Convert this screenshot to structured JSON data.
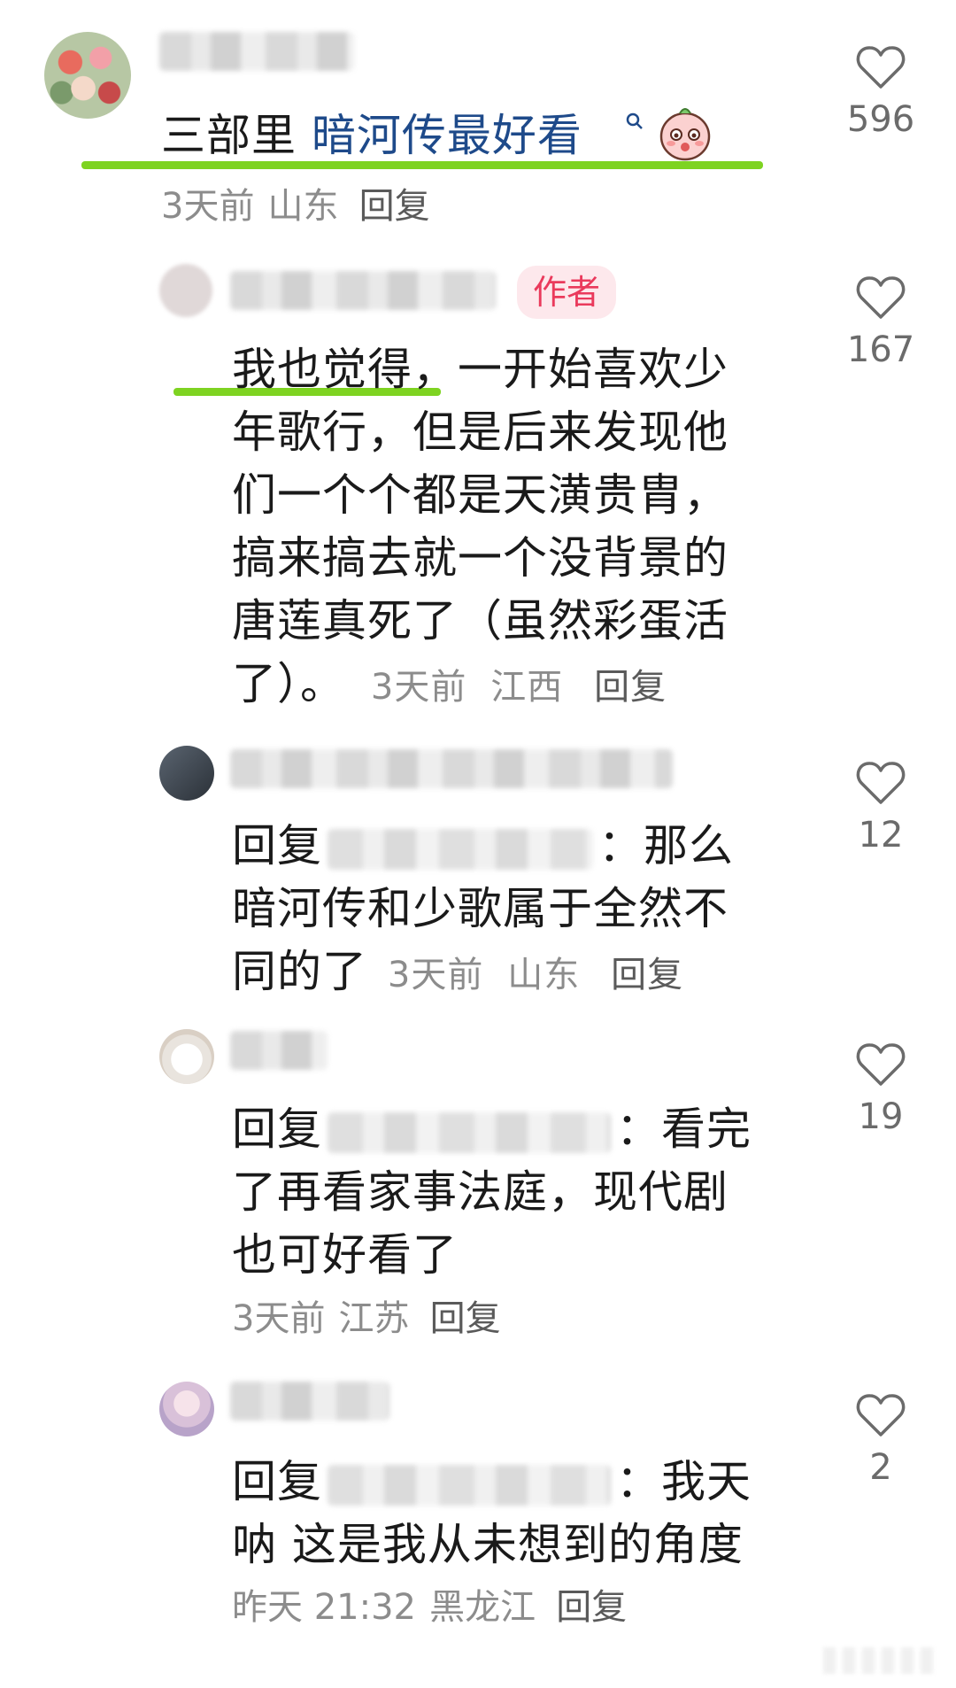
{
  "comments": [
    {
      "id": "c1",
      "text_plain": "三部里 ",
      "text_link": "暗河传最好看",
      "time": "3天前",
      "location": "山东",
      "reply_label": "回复",
      "likes": "596",
      "emoji": "peach-face-emoji"
    },
    {
      "id": "c2",
      "badge": "作者",
      "line1": "我也觉得，一开始喜欢少",
      "line2": "年歌行，但是后来发现他",
      "line3": "们一个个都是天潢贵胄，",
      "line4": "搞来搞去就一个没背景的",
      "line5": "唐莲真死了（虽然彩蛋活",
      "line6": "了）。",
      "time": "3天前",
      "location": "江西",
      "reply_label": "回复",
      "likes": "167"
    },
    {
      "id": "c3",
      "prefix": "回复",
      "after_name": "：那么",
      "line2": "暗河传和少歌属于全然不",
      "line3": "同的了",
      "time": "3天前",
      "location": "山东",
      "reply_label": "回复",
      "likes": "12"
    },
    {
      "id": "c4",
      "prefix": "回复",
      "after_name": "：看完",
      "line2": "了再看家事法庭，现代剧",
      "line3": "也可好看了",
      "time": "3天前",
      "location": "江苏",
      "reply_label": "回复",
      "likes": "19"
    },
    {
      "id": "c5",
      "prefix": "回复",
      "after_name": "：我天",
      "line2": "呐 这是我从未想到的角度",
      "time": "昨天 21:32",
      "location": "黑龙江",
      "reply_label": "回复",
      "likes": "2"
    }
  ],
  "colors": {
    "highlight": "#7ed321",
    "link": "#1e4a8a",
    "badge_bg": "#fde8ec",
    "badge_text": "#ea3a5c"
  },
  "icons": {
    "like": "heart-outline-icon",
    "search": "search-icon"
  }
}
